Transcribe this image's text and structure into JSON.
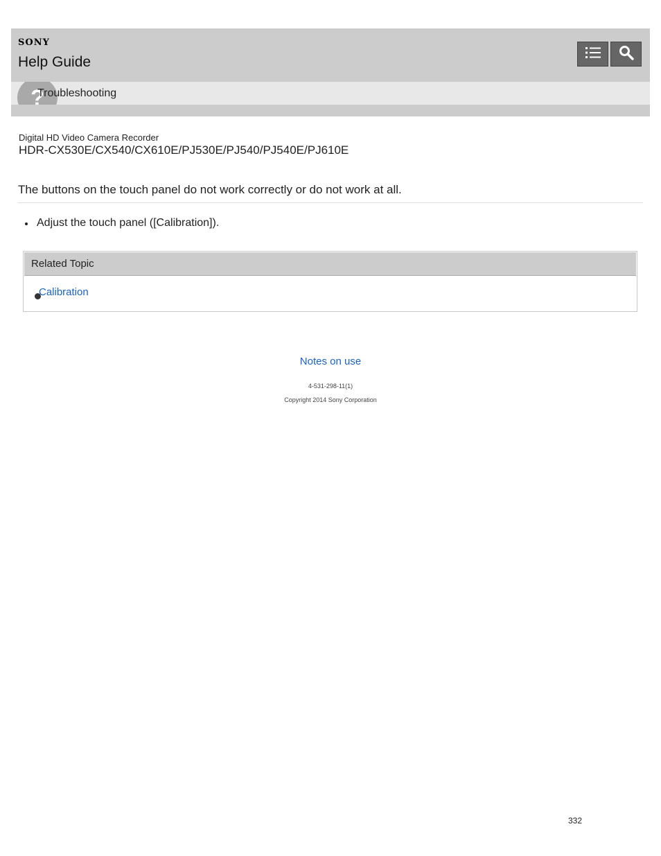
{
  "header": {
    "brand": "SONY",
    "title": "Help Guide",
    "toc_icon": "list-icon",
    "search_icon": "magnifier-icon",
    "category": {
      "icon": "question-mark-icon",
      "icon_glyph": "?",
      "label": "Troubleshooting"
    }
  },
  "product": {
    "type": "Digital HD Video Camera Recorder",
    "model": "HDR-CX530E/CX540/CX610E/PJ530E/PJ540/PJ540E/PJ610E"
  },
  "topic": {
    "title": "The buttons on the touch panel do not work correctly or do not work at all.",
    "bullets": [
      "Adjust the touch panel ([Calibration])."
    ]
  },
  "related": {
    "heading": "Related Topic",
    "links": [
      "Calibration"
    ]
  },
  "footer": {
    "notes_link": "Notes on use",
    "doc_id": "4-531-298-11(1)",
    "copyright": "Copyright 2014 Sony Corporation"
  },
  "page_number": "332",
  "colors": {
    "header_bg": "#cccccc",
    "category_bg": "#e8e8e8",
    "button_bg": "#666666",
    "link": "#1a63c8"
  }
}
